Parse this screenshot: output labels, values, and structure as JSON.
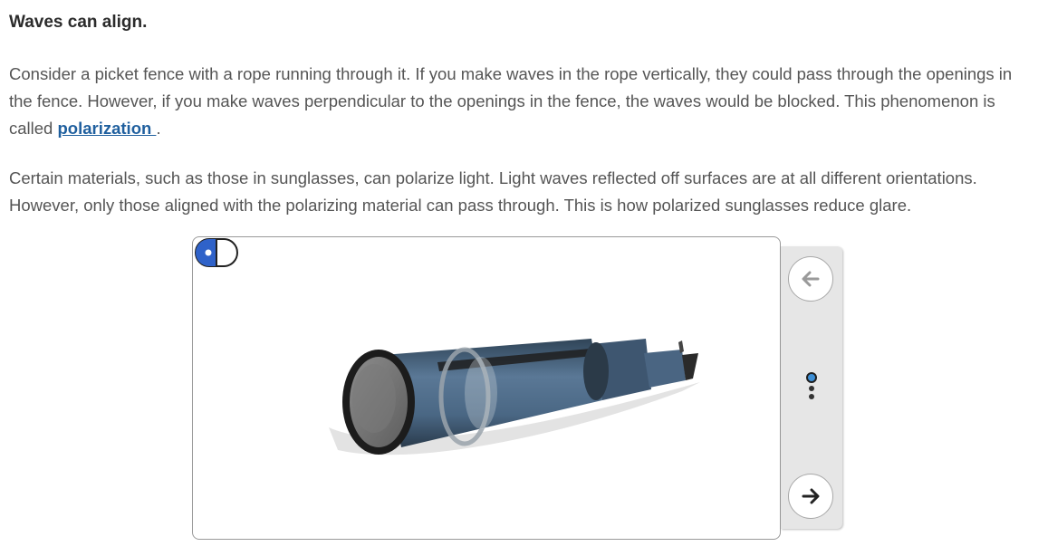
{
  "heading": "Waves can align.",
  "paragraph1": {
    "before_link": "Consider a picket fence with a rope running through it. If you make waves in the rope vertically, they could pass through the openings in the fence. However, if you make waves perpendicular to the openings in the fence, the waves would be blocked. This phenomenon is called ",
    "link_text": "polarization ",
    "after_link": "."
  },
  "paragraph2": "Certain materials, such as those in sunglasses, can polarize light. Light waves reflected off surfaces are at all different orientations. However, only those aligned with the polarizing material can pass through. This is how polarized sunglasses reduce glare.",
  "viewer": {
    "image_icon": "telescope-3d-model",
    "toggle_icon": "view-toggle-icon"
  },
  "navigation": {
    "prev_icon": "arrow-left-icon",
    "next_icon": "arrow-right-icon",
    "slides": 3,
    "active_slide": 1
  },
  "colors": {
    "link": "#1f5f9e",
    "tube": "#4e6a86",
    "active_dot": "#3d8fd6",
    "toggle_blue": "#2f62c9",
    "panel_bg": "#e6e6e6"
  }
}
